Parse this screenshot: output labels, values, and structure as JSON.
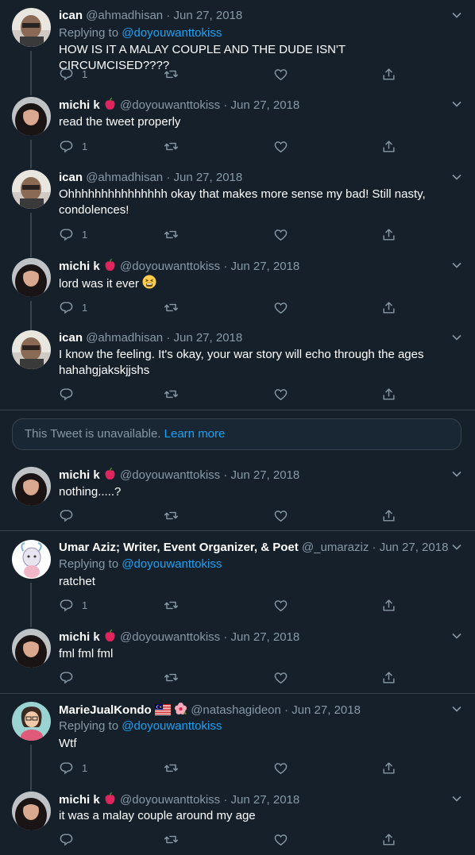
{
  "tweets": [
    {
      "name": "ican",
      "handle": "@ahmadhisan",
      "date": "Jun 27, 2018",
      "replying_label": "Replying to",
      "replying_handle": "@doyouwanttokiss",
      "text": "HOW IS IT A MALAY COUPLE AND THE DUDE ISN'T CIRCUMCISED????",
      "text2": "",
      "reply_count": "1",
      "avatar": "ican-avatar"
    },
    {
      "name": "michi k",
      "handle": "@doyouwanttokiss",
      "date": "Jun 27, 2018",
      "text": "read the tweet properly",
      "reply_count": "1",
      "avatar": "michi-avatar"
    },
    {
      "name": "ican",
      "handle": "@ahmadhisan",
      "date": "Jun 27, 2018",
      "text": "Ohhhhhhhhhhhhhhh okay that makes more sense my bad! Still nasty,",
      "text2": "condolences!",
      "reply_count": "1",
      "avatar": "ican-avatar"
    },
    {
      "name": "michi k",
      "handle": "@doyouwanttokiss",
      "date": "Jun 27, 2018",
      "text": "lord was it ever",
      "reply_count": "1",
      "avatar": "michi-avatar"
    },
    {
      "name": "ican",
      "handle": "@ahmadhisan",
      "date": "Jun 27, 2018",
      "text": "I know the feeling. It's okay, your war story will echo through the ages",
      "text2": "hahahgjakskjjshs",
      "reply_count": "",
      "avatar": "ican-avatar"
    },
    {
      "name": "michi k",
      "handle": "@doyouwanttokiss",
      "date": "Jun 27, 2018",
      "text": "nothing.....?",
      "reply_count": "",
      "avatar": "michi-avatar"
    },
    {
      "name": "Umar Aziz; Writer, Event Organizer, & Poet",
      "handle": "@_umaraziz",
      "date": "Jun 27, 2018",
      "replying_label": "Replying to",
      "replying_handle": "@doyouwanttokiss",
      "text": "ratchet",
      "reply_count": "1",
      "avatar": "umar-avatar"
    },
    {
      "name": "michi k",
      "handle": "@doyouwanttokiss",
      "date": "Jun 27, 2018",
      "text": "fml fml fml",
      "reply_count": "",
      "avatar": "michi-avatar"
    },
    {
      "name": "MarieJualKondo",
      "handle": "@natashagideon",
      "date": "Jun 27, 2018",
      "replying_label": "Replying to",
      "replying_handle": "@doyouwanttokiss",
      "text": "Wtf",
      "reply_count": "1",
      "avatar": "marie-avatar"
    },
    {
      "name": "michi k",
      "handle": "@doyouwanttokiss",
      "date": "Jun 27, 2018",
      "text": "it was a malay couple around my age",
      "reply_count": "",
      "avatar": "michi-avatar"
    }
  ],
  "unavailable": {
    "text": "This Tweet is unavailable.",
    "link": "Learn more"
  },
  "separator": "·",
  "colors": {
    "background": "#15202b",
    "muted": "#8899a6",
    "accent": "#1da1f2",
    "border": "#38444d"
  }
}
